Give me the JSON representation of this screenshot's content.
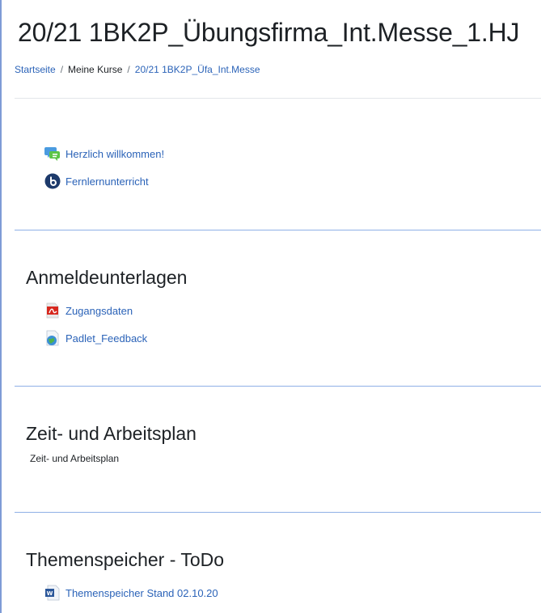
{
  "course": {
    "title": "20/21 1BK2P_Übungsfirma_Int.Messe_1.HJ"
  },
  "breadcrumb": {
    "home": "Startseite",
    "my_courses": "Meine Kurse",
    "current": "20/21 1BK2P_Üfa_Int.Messe",
    "separator": "/"
  },
  "sections": {
    "general": {
      "activities": [
        {
          "label": "Herzlich willkommen!",
          "icon": "forum-icon"
        },
        {
          "label": "Fernlernunterricht",
          "icon": "bigbluebutton-icon"
        }
      ]
    },
    "anmeldeunterlagen": {
      "title": "Anmeldeunterlagen",
      "activities": [
        {
          "label": "Zugangsdaten",
          "icon": "pdf-icon"
        },
        {
          "label": "Padlet_Feedback",
          "icon": "url-icon"
        }
      ]
    },
    "zeitplan": {
      "title": "Zeit- und Arbeitsplan",
      "summary": "Zeit- und Arbeitsplan"
    },
    "themenspeicher": {
      "title": "Themenspeicher - ToDo",
      "activities": [
        {
          "label": "Themenspeicher Stand 02.10.20",
          "icon": "word-document-icon"
        }
      ]
    }
  },
  "colors": {
    "link": "#2b63b8",
    "section_divider": "#8fb0e6",
    "page_border": "#7e9bd6"
  }
}
